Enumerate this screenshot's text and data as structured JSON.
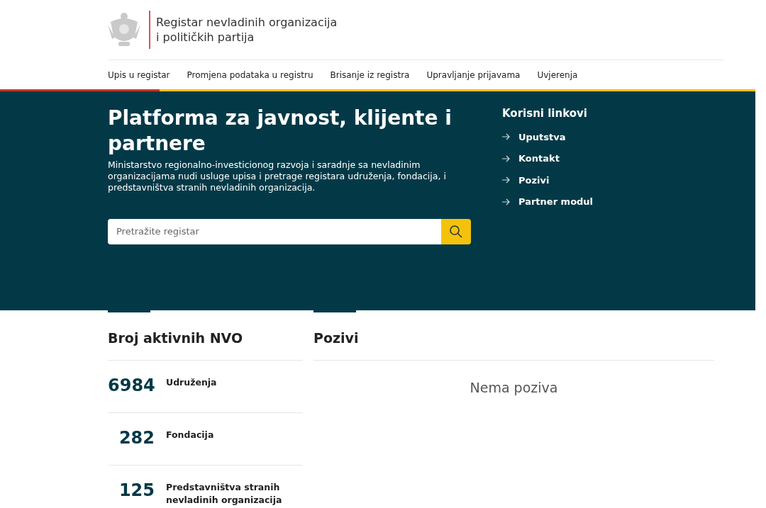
{
  "header": {
    "title_line_1": "Registar nevladinih organizacija",
    "title_line_2": "i političkih partija"
  },
  "nav": [
    "Upis u registar",
    "Promjena podataka u registru",
    "Brisanje iz registra",
    "Upravljanje prijavama",
    "Uvjerenja"
  ],
  "hero": {
    "title": "Platforma za javnost, klijente i partnere",
    "description": "Ministarstvo regionalno-investicionog razvoja i saradnje sa nevladinim organizacijama nudi usluge upisa i pretrage registara udruženja, fondacija, i predstavništva stranih nevladinih organizacija.",
    "search": {
      "placeholder": "Pretražite registar"
    }
  },
  "useful_links": {
    "heading": "Korisni linkovi",
    "items": [
      "Uputstva",
      "Kontakt",
      "Pozivi",
      "Partner modul"
    ]
  },
  "stats": {
    "heading": "Broj aktivnih NVO",
    "rows": [
      {
        "count": "6984",
        "label": "Udruženja"
      },
      {
        "count": "282",
        "label": "Fondacija"
      },
      {
        "count": "125",
        "label": "Predstavništva stranih nevladinih organizacija"
      }
    ]
  },
  "calls": {
    "heading": "Pozivi",
    "empty_message": "Nema poziva"
  }
}
